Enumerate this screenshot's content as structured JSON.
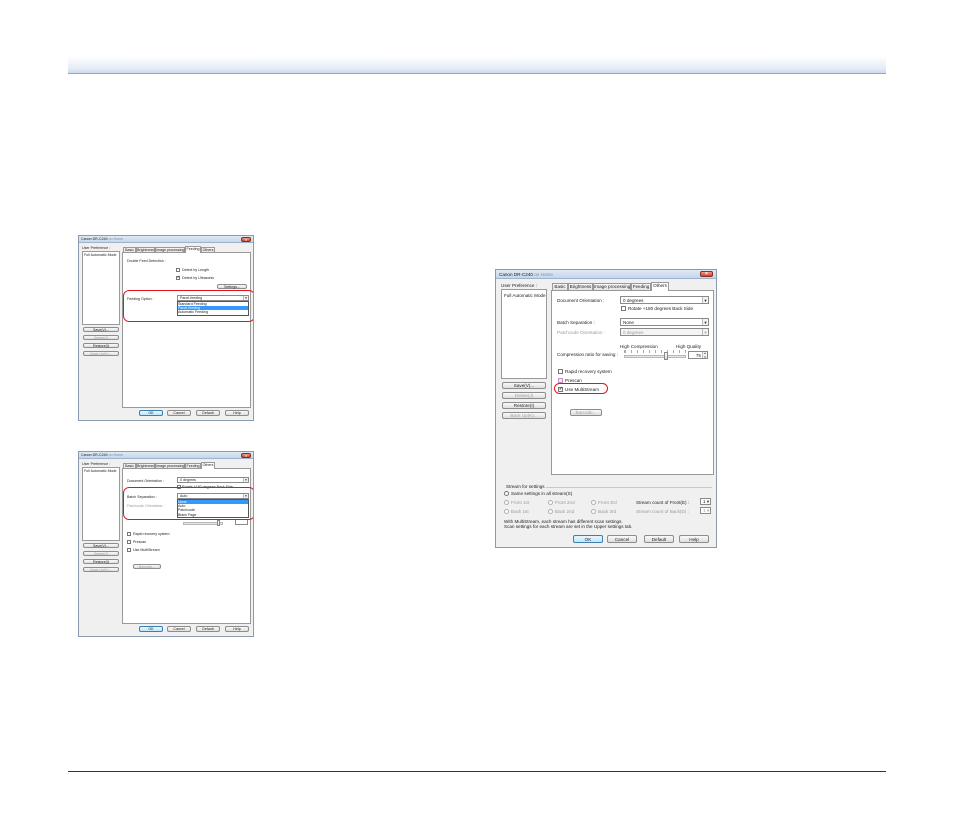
{
  "dialog_feeding": {
    "title": "Canon DR-C240",
    "title_suffix": "on Home",
    "user_pref_label": "User Preference :",
    "pref_items": [
      "Full Automatic Mode"
    ],
    "side_buttons": [
      "Save(V)...",
      "Delete(J)",
      "Restore(I)",
      "Back Up(K)..."
    ],
    "tabs": [
      "Basic",
      "Brightness",
      "Image processing",
      "Feeding",
      "Others"
    ],
    "active_tab": "Feeding",
    "double_feed_label": "Double Feed Detection :",
    "detect_length": "Detect by Length",
    "detect_ultrasonic": "Detect by Ultrasonic",
    "settings_button": "Settings...",
    "feeding_option_label": "Feeding Option :",
    "feeding_option_value": "Panel-feeding",
    "feeding_options": [
      "Standard Feeding",
      "Panel-feeding",
      "Automatic Feeding"
    ],
    "feeding_options_selected": "Panel-feeding",
    "bottom_buttons": [
      "OK",
      "Cancel",
      "Default",
      "Help"
    ]
  },
  "dialog_batch": {
    "title": "Canon DR-C240",
    "title_suffix": "on Home",
    "user_pref_label": "User Preference :",
    "pref_items": [
      "Full Automatic Mode"
    ],
    "side_buttons": [
      "Save(V)...",
      "Delete(J)",
      "Restore(I)",
      "Back Up(K)..."
    ],
    "tabs": [
      "Basic",
      "Brightness",
      "Image processing",
      "Feeding",
      "Others"
    ],
    "active_tab": "Others",
    "doc_orientation_label": "Document Orientation :",
    "doc_orientation_value": "0 degrees",
    "rotate_back": "Rotate +180 degrees Back Side",
    "batch_sep_label": "Batch Separation :",
    "batch_sep_value": "Auto",
    "patchcode_label": "Patchcode Orientation :",
    "batch_options": [
      "None",
      "Auto",
      "Patchcode",
      "Blank Page"
    ],
    "batch_options_selected": "None",
    "rapid_recovery": "Rapid recovery system",
    "prescan": "Prescan",
    "use_multistream": "Use MultiStream",
    "barcode_button": "Barcode...",
    "bottom_buttons": [
      "OK",
      "Cancel",
      "Default",
      "Help"
    ]
  },
  "dialog_others": {
    "title": "Canon DR-C240",
    "title_suffix": "on Home",
    "user_pref_label": "User Preference :",
    "pref_items": [
      "Full Automatic Mode"
    ],
    "side_buttons": [
      "Save(V)...",
      "Delete(J)",
      "Restore(I)",
      "Back Up(K)..."
    ],
    "tabs": [
      "Basic",
      "Brightness",
      "Image processing",
      "Feeding",
      "Others"
    ],
    "active_tab": "Others",
    "doc_orientation_label": "Document Orientation :",
    "doc_orientation_value": "0 degrees",
    "rotate_back": "Rotate +180 degrees Back Side",
    "batch_sep_label": "Batch Separation :",
    "batch_sep_value": "None",
    "patchcode_label": "Patchcode Orientation :",
    "patchcode_value": "0 degrees",
    "high_compression": "High Compression",
    "high_quality": "High Quality",
    "compression_label": "Compression ratio for saving :",
    "compression_value": "75",
    "compression_fraction": 0.75,
    "rapid_recovery": "Rapid recovery system",
    "prescan": "Prescan",
    "use_multistream": "Use MultiStream",
    "barcode_button": "Barcode...",
    "stream_for_settings": "Stream for settings",
    "same_settings": "Same settings in all stream(S)",
    "front_1st": "Front 1st",
    "front_2nd": "Front 2nd",
    "front_3rd": "Front 3rd",
    "back_1st": "Back 1st",
    "back_2nd": "Back 2nd",
    "back_3rd": "Back 3rd",
    "stream_count_front": "Stream count of Front(E) :",
    "stream_count_front_value": "1",
    "stream_count_back": "Stream count of Back(D) :",
    "stream_count_back_value": "1",
    "note_line1": "With MultiStream, each stream has different scan settings.",
    "note_line2": "Scan settings for each stream are set in the Upper settings tab.",
    "bottom_buttons": [
      "OK",
      "Cancel",
      "Default",
      "Help"
    ]
  },
  "colors": {
    "header_band": "#c9d7ea",
    "highlight_red": "#e0151c",
    "selection_blue": "#3399ff"
  }
}
